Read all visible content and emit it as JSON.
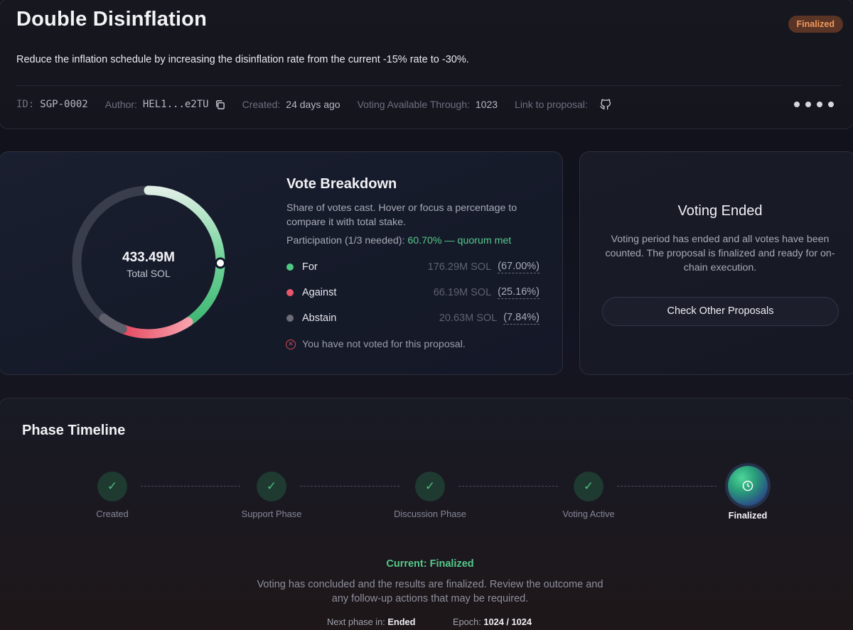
{
  "header": {
    "title": "Double Disinflation",
    "status_badge": "Finalized",
    "description": "Reduce the inflation schedule by increasing the disinflation rate from the current -15% rate to -30%.",
    "meta": {
      "id_label": "ID:",
      "id_value": "SGP-0002",
      "author_label": "Author:",
      "author_value": "HEL1...e2TU",
      "created_label": "Created:",
      "created_value": "24 days ago",
      "voting_label": "Voting Available Through:",
      "voting_value": "1023",
      "link_label": "Link to proposal:"
    },
    "icons": {
      "copy": "copy-icon",
      "link": "github-icon",
      "more": "more-dots-icon"
    }
  },
  "vote_breakdown": {
    "title": "Vote Breakdown",
    "subtitle": "Share of votes cast. Hover or focus a percentage to compare it with total stake.",
    "participation_label": "Participation (1/3 needed): ",
    "participation_value": "60.70% — quorum met",
    "total_value": "433.49M",
    "total_label": "Total SOL",
    "rows": [
      {
        "name": "For",
        "amount": "176.29M SOL",
        "percent": "(67.00%)",
        "color": "#4fc783"
      },
      {
        "name": "Against",
        "amount": "66.19M SOL",
        "percent": "(25.16%)",
        "color": "#e8566b"
      },
      {
        "name": "Abstain",
        "amount": "20.63M SOL",
        "percent": "(7.84%)",
        "color": "#6b6c78"
      }
    ],
    "not_voted": "You have not voted for this proposal."
  },
  "chart_data": {
    "type": "pie",
    "title": "",
    "categories": [
      "For",
      "Against",
      "Abstain"
    ],
    "values": [
      176.29,
      66.19,
      20.63
    ],
    "participation_percent": 60.7,
    "colors": [
      "#4fc783",
      "#e8566b",
      "#6b6c78"
    ]
  },
  "ended": {
    "title": "Voting Ended",
    "text": "Voting period has ended and all votes have been counted. The proposal is finalized and ready for on-chain execution.",
    "button": "Check Other Proposals"
  },
  "timeline": {
    "title": "Phase Timeline",
    "steps": [
      {
        "label": "Created",
        "state": "done"
      },
      {
        "label": "Support Phase",
        "state": "done"
      },
      {
        "label": "Discussion Phase",
        "state": "done"
      },
      {
        "label": "Voting Active",
        "state": "done"
      },
      {
        "label": "Finalized",
        "state": "current"
      }
    ],
    "current": "Current: Finalized",
    "current_desc": "Voting has concluded and the results are finalized. Review the outcome and any follow-up actions that may be required.",
    "next_phase_label": "Next phase in:",
    "next_phase_value": "Ended",
    "epoch_label": "Epoch:",
    "epoch_value": "1024 / 1024"
  }
}
